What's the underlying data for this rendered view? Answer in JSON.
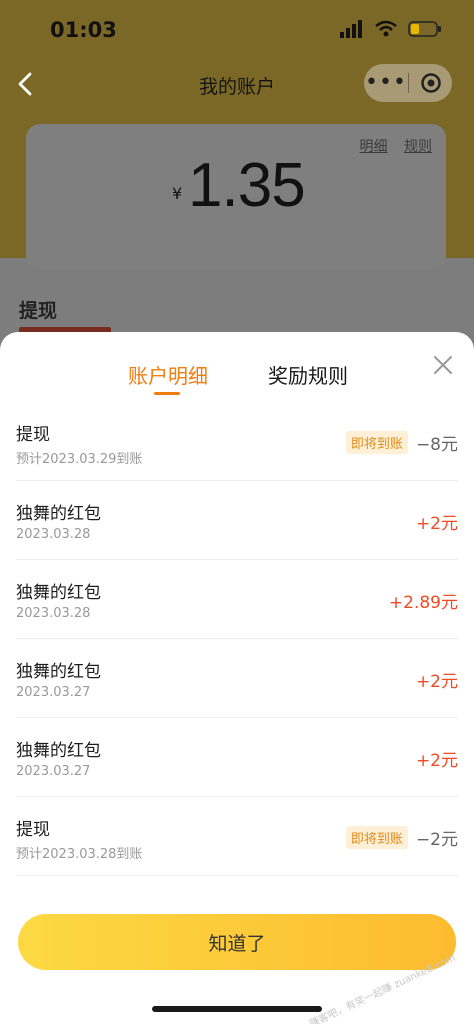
{
  "status": {
    "time": "01:03"
  },
  "nav": {
    "title": "我的账户",
    "more_label": "•••"
  },
  "account": {
    "currency": "¥",
    "balance": "1.35",
    "link_detail": "明细",
    "link_rules": "规则",
    "withdraw_title": "提现"
  },
  "sheet": {
    "tabs": [
      {
        "label": "账户明细",
        "active": true
      },
      {
        "label": "奖励规则",
        "active": false
      }
    ],
    "items": [
      {
        "title": "提现",
        "date": "预计2023.03.29到账",
        "badge": "即将到账",
        "amount": "−8元",
        "positive": false
      },
      {
        "title": "独舞的红包",
        "date": "2023.03.28",
        "badge": "",
        "amount": "+2元",
        "positive": true
      },
      {
        "title": "独舞的红包",
        "date": "2023.03.28",
        "badge": "",
        "amount": "+2.89元",
        "positive": true
      },
      {
        "title": "独舞的红包",
        "date": "2023.03.27",
        "badge": "",
        "amount": "+2元",
        "positive": true
      },
      {
        "title": "独舞的红包",
        "date": "2023.03.27",
        "badge": "",
        "amount": "+2元",
        "positive": true
      },
      {
        "title": "提现",
        "date": "预计2023.03.28到账",
        "badge": "即将到账",
        "amount": "−2元",
        "positive": false
      }
    ],
    "confirm_label": "知道了"
  },
  "watermark": "赚客吧，有奖一起赚 zuanke8.com",
  "colors": {
    "accent": "#f07d10",
    "positive": "#f04a25",
    "button": "#fdbb30"
  }
}
